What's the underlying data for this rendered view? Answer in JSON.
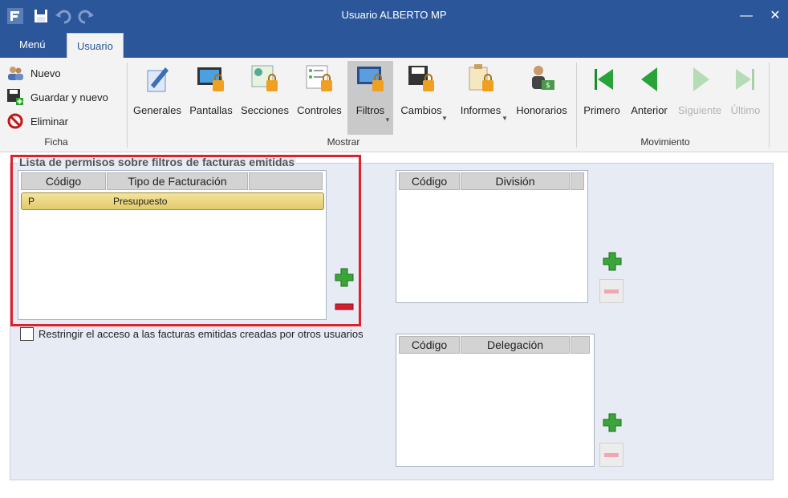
{
  "window": {
    "title": "Usuario ALBERTO MP"
  },
  "tabs": [
    {
      "label": "Menú"
    },
    {
      "label": "Usuario"
    }
  ],
  "ribbon": {
    "ficha": {
      "label": "Ficha",
      "items": [
        {
          "label": "Nuevo"
        },
        {
          "label": "Guardar y nuevo"
        },
        {
          "label": "Eliminar"
        }
      ]
    },
    "mostrar": {
      "label": "Mostrar",
      "buttons": [
        {
          "label": "Generales"
        },
        {
          "label": "Pantallas"
        },
        {
          "label": "Secciones"
        },
        {
          "label": "Controles"
        },
        {
          "label": "Filtros"
        },
        {
          "label": "Cambios"
        },
        {
          "label": "Informes"
        },
        {
          "label": "Honorarios"
        }
      ]
    },
    "movimiento": {
      "label": "Movimiento",
      "buttons": [
        {
          "label": "Primero"
        },
        {
          "label": "Anterior"
        },
        {
          "label": "Siguiente"
        },
        {
          "label": "Último"
        }
      ]
    }
  },
  "main": {
    "section_title": "Lista de permisos sobre filtros de facturas emitidas",
    "grid_facturacion": {
      "columns": [
        "Código",
        "Tipo de Facturación",
        ""
      ],
      "rows": [
        {
          "codigo": "P",
          "tipo": "Presupuesto"
        }
      ]
    },
    "grid_division": {
      "columns": [
        "Código",
        "División",
        ""
      ]
    },
    "grid_delegacion": {
      "columns": [
        "Código",
        "Delegación",
        ""
      ]
    },
    "restrict_label": "Restringir el acceso a las facturas emitidas creadas por otros usuarios"
  },
  "colors": {
    "titlebar": "#2b579a",
    "highlight_frame": "#e0202a",
    "selected_row": "#e9d37c"
  }
}
